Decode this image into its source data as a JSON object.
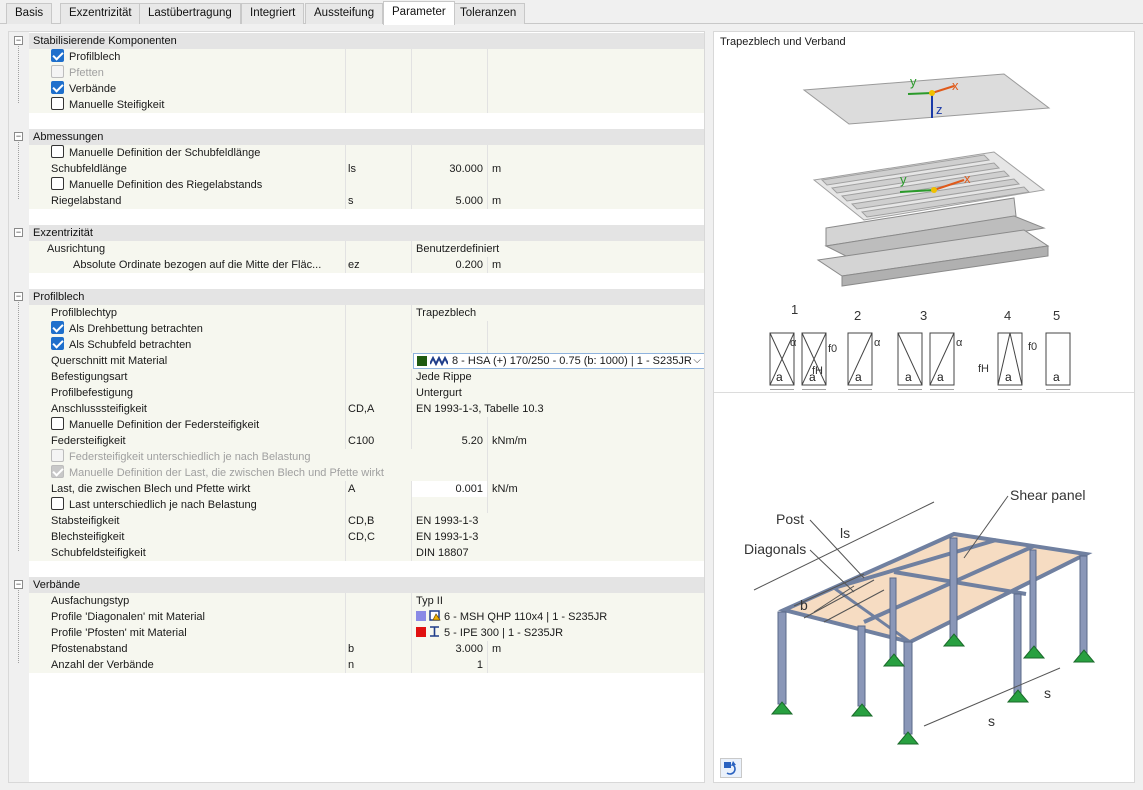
{
  "tabs": [
    "Basis",
    "Exzentrizität",
    "Lastübertragung",
    "Integriert",
    "Aussteifung",
    "Parameter",
    "Toleranzen"
  ],
  "active_tab": "Parameter",
  "sections": {
    "stab": {
      "title": "Stabilisierende Komponenten",
      "profilblech": "Profilblech",
      "pfetten": "Pfetten",
      "verbaende": "Verbände",
      "manuelle_steifigkeit": "Manuelle Steifigkeit"
    },
    "abm": {
      "title": "Abmessungen",
      "man_schub": "Manuelle Definition der Schubfeldlänge",
      "schubfeldlaenge": "Schubfeldlänge",
      "schubfeldlaenge_sym": "ls",
      "schubfeldlaenge_val": "30.000",
      "schubfeldlaenge_unit": "m",
      "man_riegel": "Manuelle Definition des Riegelabstands",
      "riegelabstand": "Riegelabstand",
      "riegelabstand_sym": "s",
      "riegelabstand_val": "5.000",
      "riegelabstand_unit": "m"
    },
    "exz": {
      "title": "Exzentrizität",
      "ausrichtung": "Ausrichtung",
      "ausrichtung_val": "Benutzerdefiniert",
      "abs_ordinate": "Absolute Ordinate bezogen auf die Mitte der Fläc...",
      "abs_ordinate_sym": "ez",
      "abs_ordinate_val": "0.200",
      "abs_ordinate_unit": "m"
    },
    "pb": {
      "title": "Profilblech",
      "typ": "Profilblechtyp",
      "typ_val": "Trapezblech",
      "drehbettung": "Als Drehbettung betrachten",
      "schubfeld": "Als Schubfeld betrachten",
      "querschnitt": "Querschnitt mit Material",
      "querschnitt_val": "8 - HSA (+) 170/250 - 0.75 (b: 1000) | 1 - S235JR",
      "befestigungsart": "Befestigungsart",
      "befestigungsart_val": "Jede Rippe",
      "profilbefestigung": "Profilbefestigung",
      "profilbefestigung_val": "Untergurt",
      "anschluss": "Anschlusssteifigkeit",
      "anschluss_sym": "CD,A",
      "anschluss_val": "EN 1993-1-3, Tabelle 10.3",
      "man_feder": "Manuelle Definition der Federsteifigkeit",
      "feder": "Federsteifigkeit",
      "feder_sym": "C100",
      "feder_val": "5.20",
      "feder_unit": "kNm/m",
      "feder_unterschiedlich": "Federsteifigkeit unterschiedlich je nach Belastung",
      "man_last": "Manuelle Definition der Last, die zwischen Blech und Pfette wirkt",
      "last": "Last, die zwischen Blech und Pfette wirkt",
      "last_sym": "A",
      "last_val": "0.001",
      "last_unit": "kN/m",
      "last_unterschiedlich": "Last unterschiedlich je nach Belastung",
      "stab": "Stabsteifigkeit",
      "stab_sym": "CD,B",
      "stab_val": "EN 1993-1-3",
      "blech": "Blechsteifigkeit",
      "blech_sym": "CD,C",
      "blech_val": "EN 1993-1-3",
      "schubfeldsteifigkeit": "Schubfeldsteifigkeit",
      "schubfeldsteifigkeit_val": "DIN 18807"
    },
    "vb": {
      "title": "Verbände",
      "ausfachung": "Ausfachungstyp",
      "ausfachung_val": "Typ II",
      "diag": "Profile 'Diagonalen' mit Material",
      "diag_val": "6 - MSH QHP 110x4 | 1 - S235JR",
      "pfosten": "Profile 'Pfosten' mit Material",
      "pfosten_val": "5 - IPE 300 | 1 - S235JR",
      "pfostenabstand": "Pfostenabstand",
      "pfostenabstand_sym": "b",
      "pfostenabstand_val": "3.000",
      "pfostenabstand_unit": "m",
      "anzahl": "Anzahl der Verbände",
      "anzahl_sym": "n",
      "anzahl_val": "1"
    }
  },
  "colors": {
    "querschnitt_swatch": "#1f5a10",
    "diag_swatch": "#8a8ae6",
    "pfosten_swatch": "#e01010",
    "checkbox": "#1e6fcc"
  },
  "right": {
    "title": "Trapezblech und Verband",
    "axes": {
      "x": "x",
      "y": "y",
      "z": "z"
    },
    "type_labels": [
      "1",
      "2",
      "3",
      "4",
      "5"
    ],
    "dim_a": "a",
    "f0": "f0",
    "fH": "fH",
    "alpha": "α",
    "shear_panel": "Shear panel",
    "post": "Post",
    "diagonals": "Diagonals",
    "ls": "ls",
    "b": "b",
    "s": "s"
  }
}
